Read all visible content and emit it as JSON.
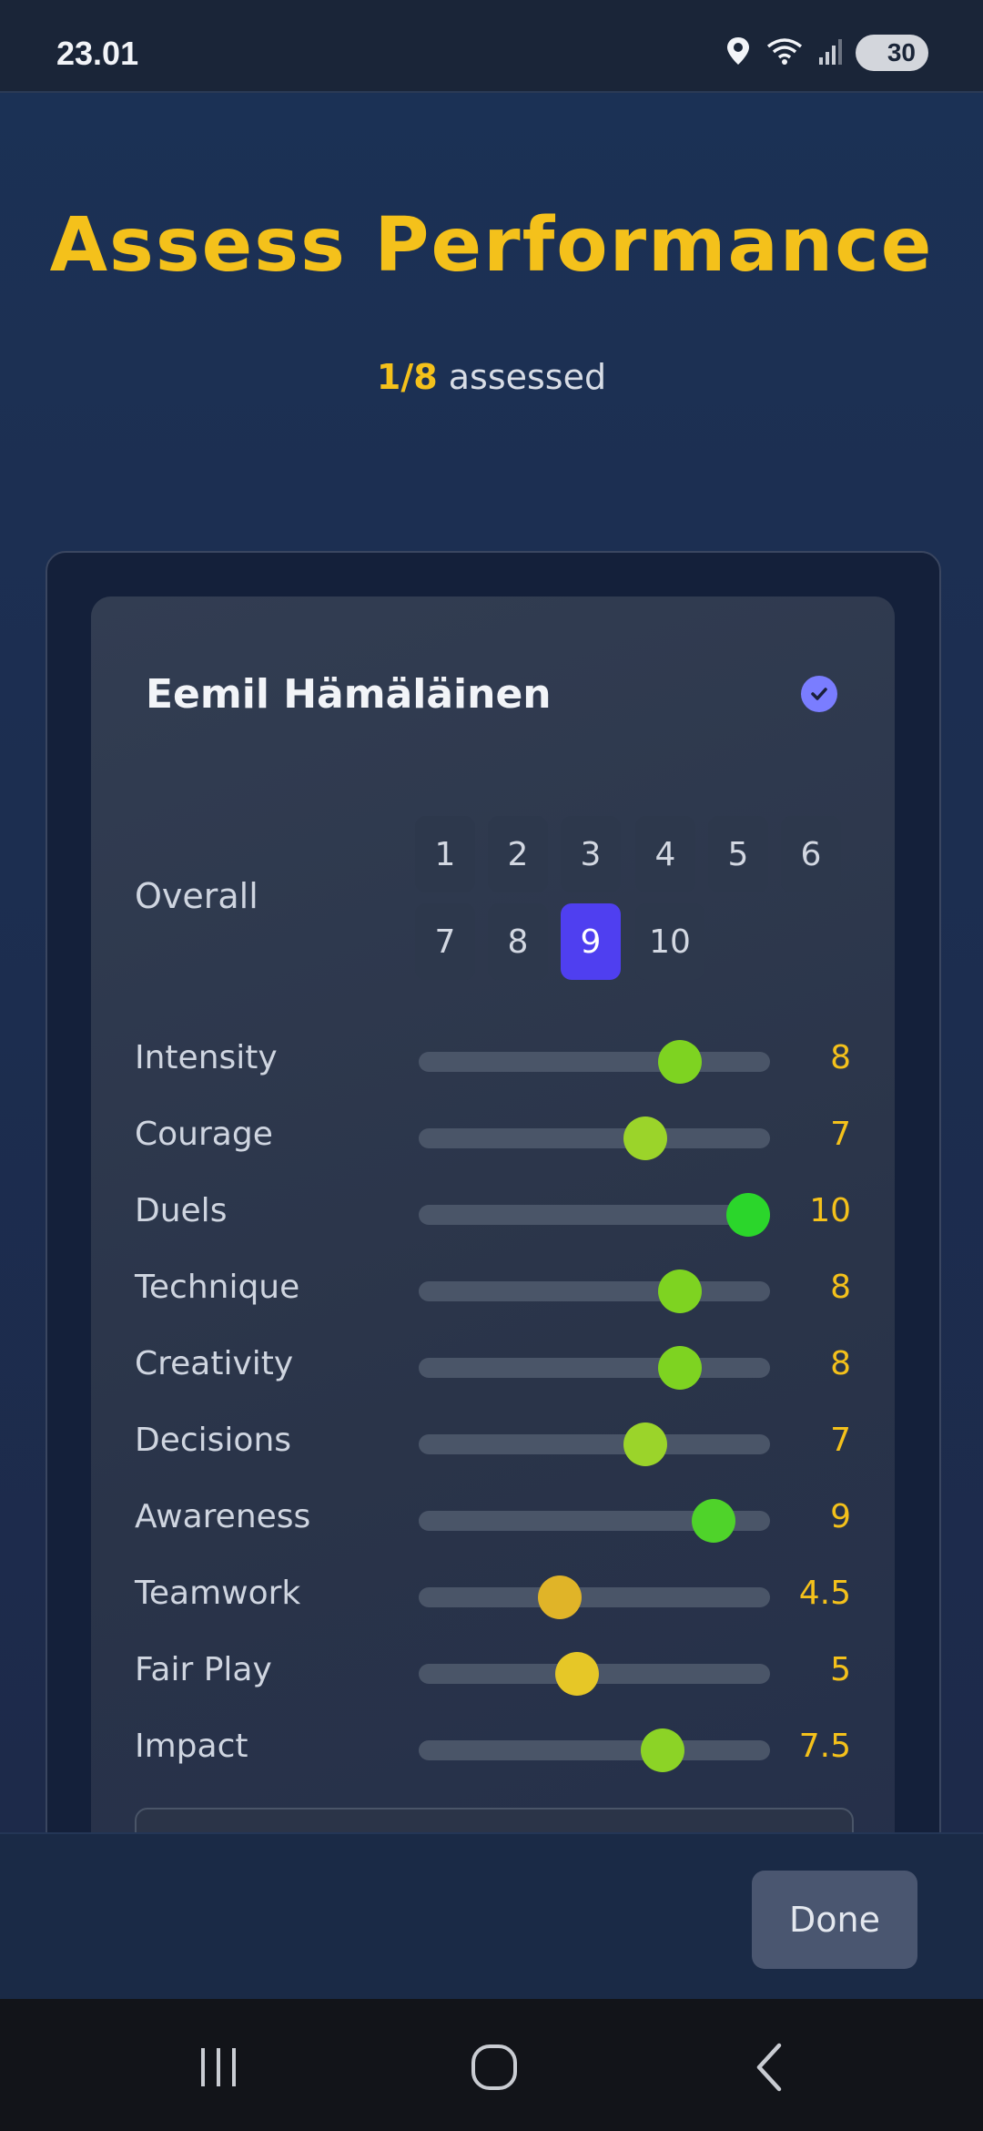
{
  "status_bar": {
    "time": "23.01",
    "battery": "30",
    "icons": [
      "location-icon",
      "wifi-icon",
      "signal-icon",
      "battery-icon"
    ]
  },
  "header": {
    "title": "Assess Performance",
    "progress_count": "1/8",
    "progress_suffix": " assessed"
  },
  "player": {
    "name": "Eemil Hämäläinen",
    "assessed": true
  },
  "overall": {
    "label": "Overall",
    "options": [
      "1",
      "2",
      "3",
      "4",
      "5",
      "6",
      "7",
      "8",
      "9",
      "10"
    ],
    "selected": "9"
  },
  "metrics": [
    {
      "label": "Intensity",
      "value": "8",
      "level": 8,
      "color": "#7ed321"
    },
    {
      "label": "Courage",
      "value": "7",
      "level": 7,
      "color": "#9bd42a"
    },
    {
      "label": "Duels",
      "value": "10",
      "level": 10,
      "color": "#2bd62b"
    },
    {
      "label": "Technique",
      "value": "8",
      "level": 8,
      "color": "#7ed321"
    },
    {
      "label": "Creativity",
      "value": "8",
      "level": 8,
      "color": "#7ed321"
    },
    {
      "label": "Decisions",
      "value": "7",
      "level": 7,
      "color": "#9bd42a"
    },
    {
      "label": "Awareness",
      "value": "9",
      "level": 9,
      "color": "#4fd32a"
    },
    {
      "label": "Teamwork",
      "value": "4.5",
      "level": 4.5,
      "color": "#e0b428"
    },
    {
      "label": "Fair Play",
      "value": "5",
      "level": 5,
      "color": "#e6c727"
    },
    {
      "label": "Impact",
      "value": "7.5",
      "level": 7.5,
      "color": "#8cd326"
    }
  ],
  "slider_range": [
    1,
    10
  ],
  "footer": {
    "done_label": "Done"
  },
  "colors": {
    "accent": "#f4c11b",
    "selected": "#4f3ff0",
    "check": "#7a7dff"
  }
}
